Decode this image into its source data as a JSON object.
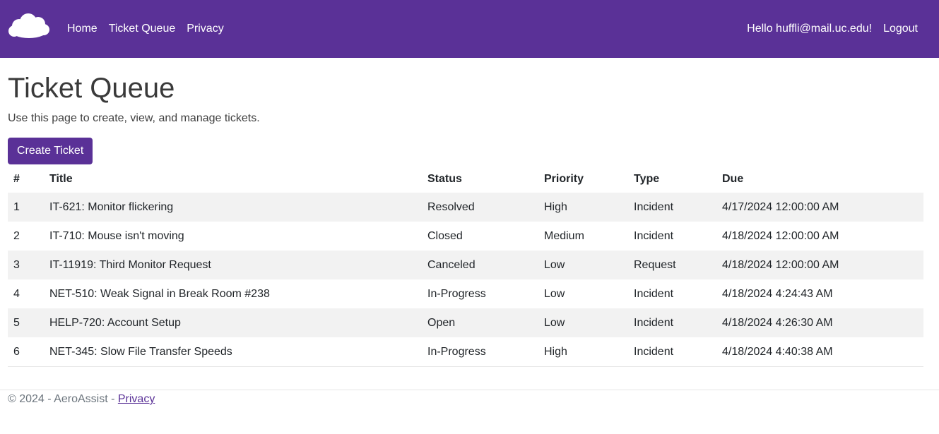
{
  "navbar": {
    "brand_icon": "cloud-logo",
    "links": [
      "Home",
      "Ticket Queue",
      "Privacy"
    ],
    "greeting": "Hello huffli@mail.uc.edu!",
    "logout_label": "Logout",
    "color": "#5a3197"
  },
  "page": {
    "title": "Ticket Queue",
    "description": "Use this page to create, view, and manage tickets.",
    "create_button_label": "Create Ticket"
  },
  "table": {
    "headers": [
      "#",
      "Title",
      "Status",
      "Priority",
      "Type",
      "Due"
    ],
    "rows": [
      [
        "1",
        "IT-621: Monitor flickering",
        "Resolved",
        "High",
        "Incident",
        "4/17/2024 12:00:00 AM"
      ],
      [
        "2",
        "IT-710: Mouse isn't moving",
        "Closed",
        "Medium",
        "Incident",
        "4/18/2024 12:00:00 AM"
      ],
      [
        "3",
        "IT-11919: Third Monitor Request",
        "Canceled",
        "Low",
        "Request",
        "4/18/2024 12:00:00 AM"
      ],
      [
        "4",
        "NET-510: Weak Signal in Break Room #238",
        "In-Progress",
        "Low",
        "Incident",
        "4/18/2024 4:24:43 AM"
      ],
      [
        "5",
        "HELP-720: Account Setup",
        "Open",
        "Low",
        "Incident",
        "4/18/2024 4:26:30 AM"
      ],
      [
        "6",
        "NET-345: Slow File Transfer Speeds",
        "In-Progress",
        "High",
        "Incident",
        "4/18/2024 4:40:38 AM"
      ]
    ]
  },
  "footer": {
    "copyright": "© 2024 - AeroAssist - ",
    "privacy_label": "Privacy"
  }
}
